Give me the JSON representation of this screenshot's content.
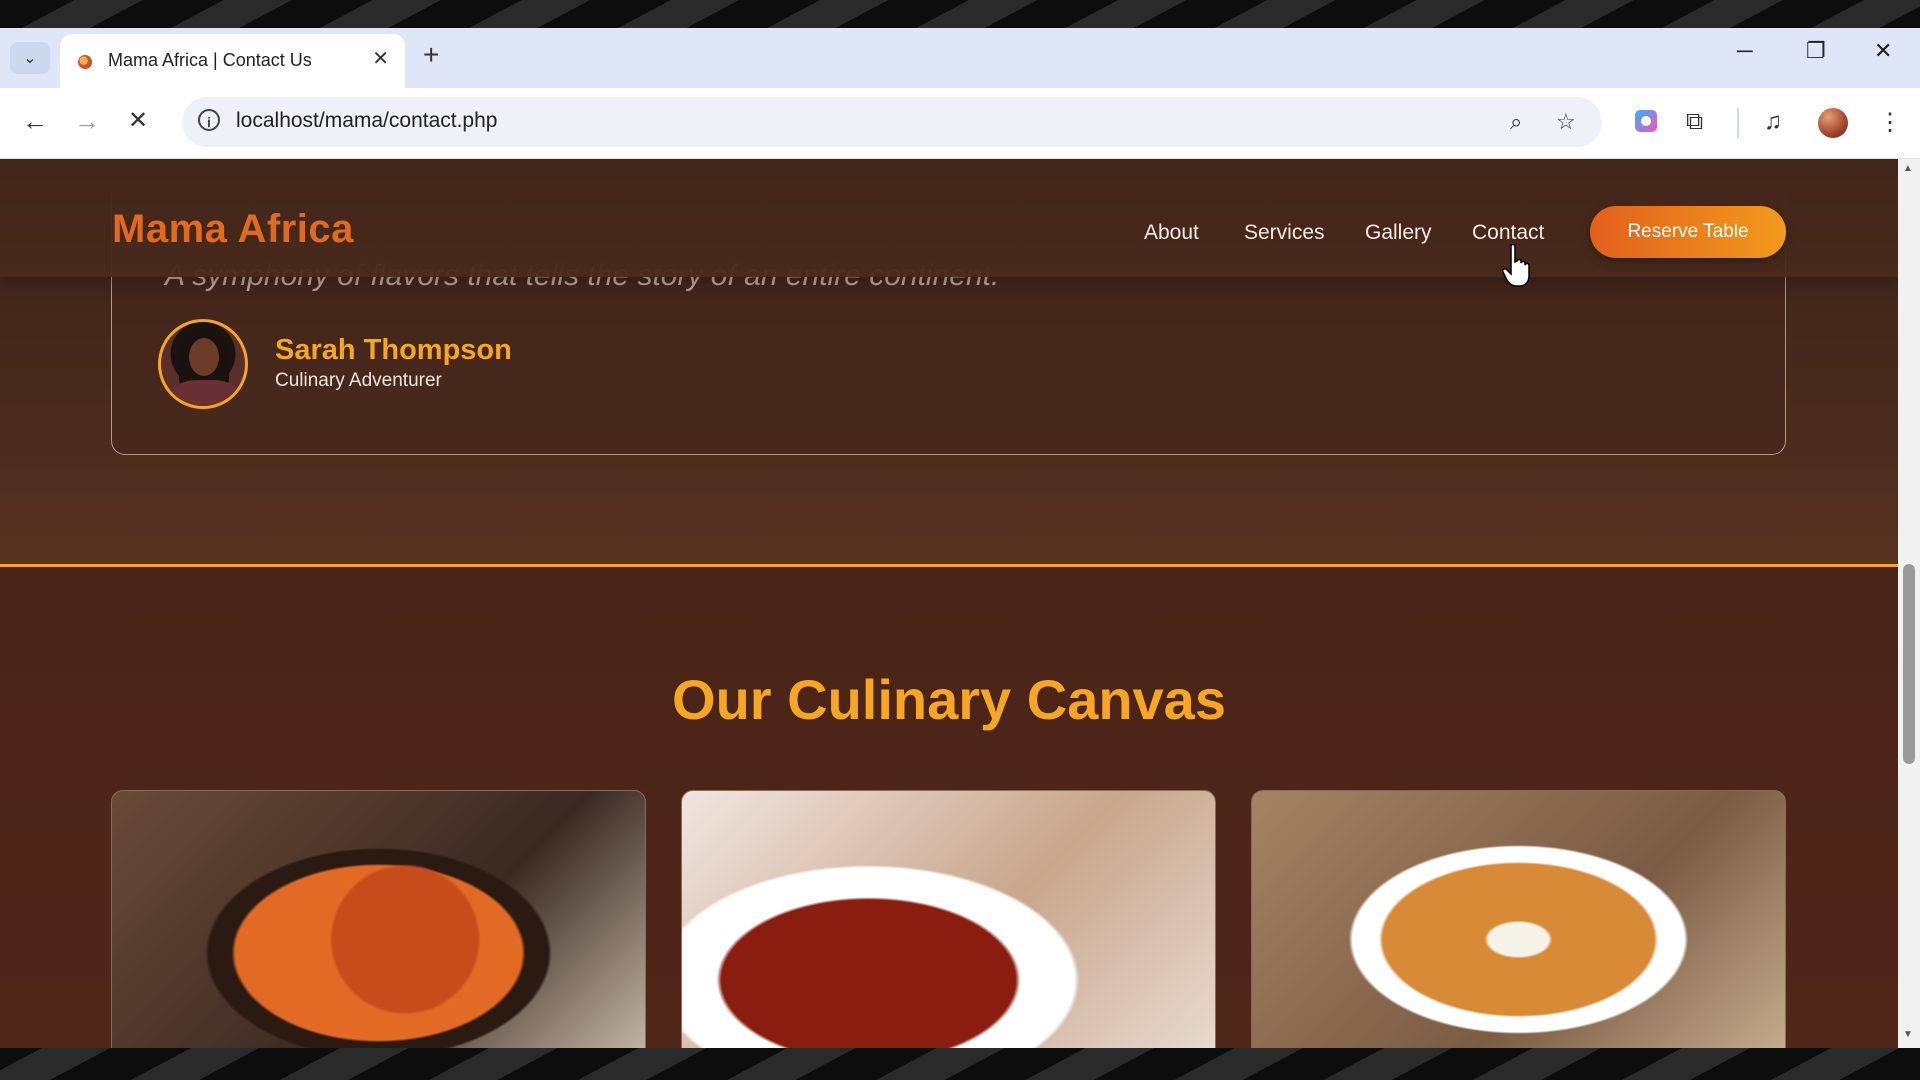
{
  "browser": {
    "tab_title": "Mama Africa | Contact Us",
    "url": "localhost/mama/contact.php",
    "new_tab_label": "+",
    "close_tab_label": "✕",
    "minimize_label": "─",
    "restore_label": "❐",
    "close_window_label": "✕"
  },
  "site": {
    "brand": "Mama Africa",
    "nav": [
      {
        "label": "About"
      },
      {
        "label": "Services"
      },
      {
        "label": "Gallery"
      },
      {
        "label": "Contact"
      }
    ],
    "cta_label": "Reserve Table"
  },
  "testimonial": {
    "quote": "A symphony of flavors that tells the story of an entire continent.",
    "name": "Sarah Thompson",
    "role": "Culinary Adventurer"
  },
  "gallery": {
    "title": "Our Culinary Canvas",
    "items": [
      {
        "icon": "stew-image"
      },
      {
        "icon": "soup-image"
      },
      {
        "icon": "curry-image"
      }
    ]
  },
  "colors": {
    "accent": "#f5a623",
    "brand": "#e06a1f",
    "background": "#3f2419"
  }
}
